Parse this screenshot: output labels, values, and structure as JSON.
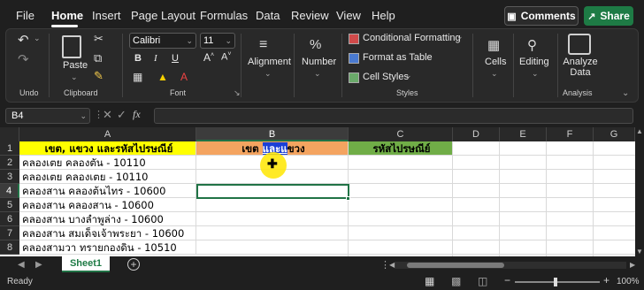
{
  "menu": {
    "tabs": [
      "File",
      "Home",
      "Insert",
      "Page Layout",
      "Formulas",
      "Data",
      "Review",
      "View",
      "Help"
    ],
    "comments_label": "Comments",
    "share_label": "Share"
  },
  "ribbon": {
    "undo_label": "Undo",
    "clipboard": {
      "paste_label": "Paste",
      "group_label": "Clipboard"
    },
    "font": {
      "name": "Calibri",
      "size": "11",
      "group_label": "Font"
    },
    "alignment_label": "Alignment",
    "number_label": "Number",
    "styles": {
      "conditional_formatting": "Conditional Formatting",
      "format_as_table": "Format as Table",
      "cell_styles": "Cell Styles",
      "group_label": "Styles"
    },
    "cells_label": "Cells",
    "editing_label": "Editing",
    "analyze_data_label": "Analyze Data",
    "analysis_group_label": "Analysis"
  },
  "formula_bar": {
    "name_box": "B4",
    "fx": "fx",
    "value": ""
  },
  "grid": {
    "columns": [
      "A",
      "B",
      "C",
      "D",
      "E",
      "F",
      "G"
    ],
    "rows": [
      "1",
      "2",
      "3",
      "4",
      "5",
      "6",
      "7",
      "8"
    ],
    "headers": {
      "a1": "เขต, แขวง และรหัสไปรษณีย์",
      "b1_part1": "เขต ",
      "b1_part2": "และแ",
      "b1_part3": "ขวง",
      "c1": "รหัสไปรษณีย์"
    },
    "column_a": [
      "คลองเตย คลองตัน - 10110",
      "คลองเตย คลองเตย - 10110",
      "คลองสาน คลองต้นไทร - 10600",
      "คลองสาน คลองสาน - 10600",
      "คลองสาน บางลำพูล่าง - 10600",
      "คลองสาน สมเด็จเจ้าพระยา - 10600",
      "คลองสามวา ทรายกองดิน - 10510"
    ],
    "colors": {
      "a1_fill": "#ffff00",
      "b1_fill": "#f4a460",
      "c1_fill": "#70ad47",
      "selection": "#217346"
    }
  },
  "sheets": {
    "active": "Sheet1"
  },
  "status": {
    "ready": "Ready",
    "zoom": "100%"
  }
}
